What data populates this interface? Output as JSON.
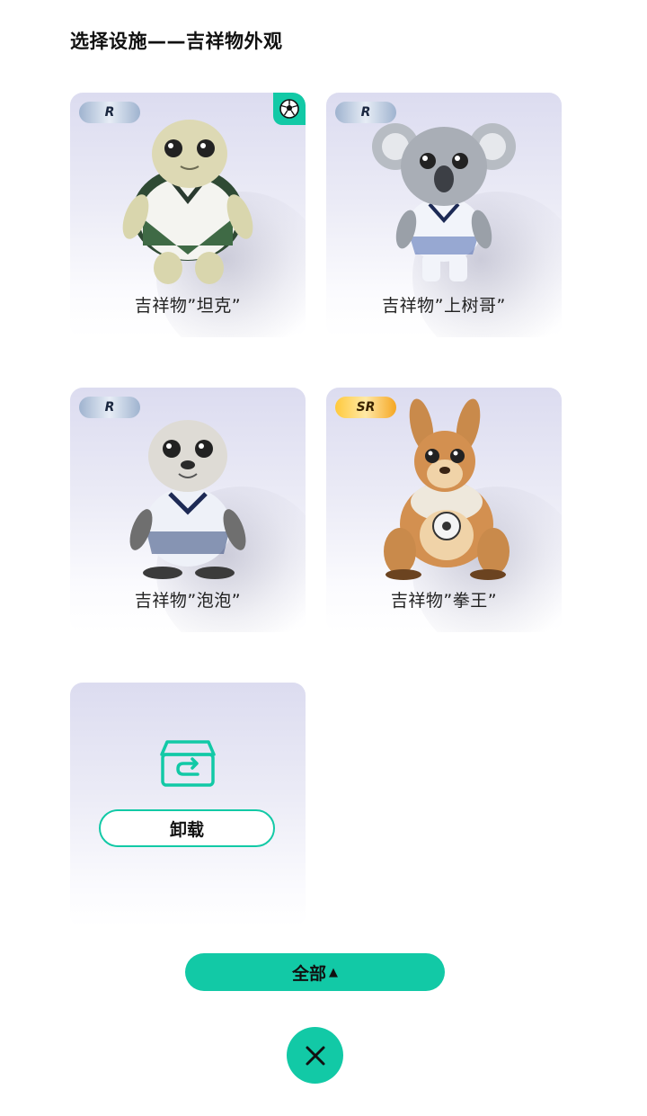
{
  "header": {
    "title": "选择设施——吉祥物外观"
  },
  "mascots": [
    {
      "name": "吉祥物”坦克”",
      "rarity": "R",
      "equipped": true,
      "icon": "turtle-mascot"
    },
    {
      "name": "吉祥物”上树哥”",
      "rarity": "R",
      "equipped": false,
      "icon": "koala-mascot"
    },
    {
      "name": "吉祥物”泡泡”",
      "rarity": "R",
      "equipped": false,
      "icon": "seal-mascot"
    },
    {
      "name": "吉祥物”拳王”",
      "rarity": "SR",
      "equipped": false,
      "icon": "kangaroo-mascot"
    }
  ],
  "unload": {
    "label": "卸载",
    "icon": "unload-box-icon"
  },
  "filter": {
    "label": "全部",
    "arrow": "▲"
  },
  "close": {
    "icon": "close-icon"
  },
  "colors": {
    "accent": "#12c9a6",
    "card_top": "#dcdcf0",
    "rarity_r": "#9fb3cf",
    "rarity_sr": "#ffc93c"
  }
}
